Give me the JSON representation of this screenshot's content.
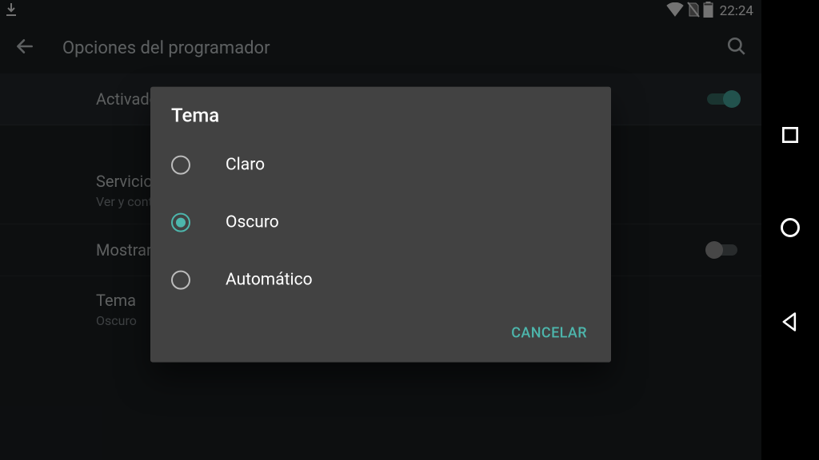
{
  "status_bar": {
    "time": "22:24"
  },
  "app_bar": {
    "title": "Opciones del programador"
  },
  "list": {
    "activado": {
      "primary": "Activado"
    },
    "servicios": {
      "primary": "Servicios en ejecución",
      "secondary": "Ver y controlar servicios en ejecución"
    },
    "sintonizador": {
      "primary": "Mostrar sintonizador"
    },
    "tema": {
      "primary": "Tema",
      "secondary": "Oscuro"
    }
  },
  "dialog": {
    "title": "Tema",
    "options": [
      {
        "label": "Claro",
        "selected": false
      },
      {
        "label": "Oscuro",
        "selected": true
      },
      {
        "label": "Automático",
        "selected": false
      }
    ],
    "cancel": "CANCELAR"
  }
}
